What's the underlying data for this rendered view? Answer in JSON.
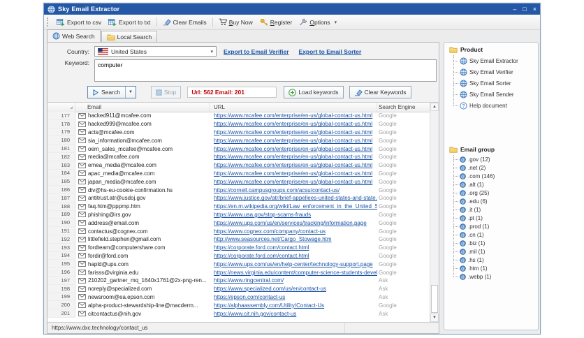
{
  "window": {
    "title": "Sky Email Extractor",
    "controls": [
      "minimize-icon",
      "maximize-icon",
      "close-icon"
    ]
  },
  "toolbar": {
    "buttons": [
      {
        "label": "Export to csv",
        "icon": "export-csv-icon",
        "sep_before": false,
        "mnemonic": ""
      },
      {
        "label": "Export to txt",
        "icon": "export-txt-icon",
        "sep_before": false,
        "mnemonic": ""
      },
      {
        "label": "Clear Emails",
        "icon": "eraser-icon",
        "sep_before": true,
        "mnemonic": ""
      },
      {
        "label": "Buy Now",
        "icon": "cart-icon",
        "sep_before": true,
        "mnemonic": "B"
      },
      {
        "label": "Register",
        "icon": "key-icon",
        "sep_before": false,
        "mnemonic": "R"
      },
      {
        "label": "Options",
        "icon": "wrench-icon",
        "sep_before": false,
        "mnemonic": "O"
      }
    ],
    "overflow_icon": "chevron-down-icon"
  },
  "tabs": [
    {
      "label": "Web Search",
      "icon": "globe-icon",
      "active": true
    },
    {
      "label": "Local Search",
      "icon": "folder-icon",
      "active": false
    }
  ],
  "form": {
    "country_label": "Country:",
    "country_value": "United States",
    "country_flag_icon": "us-flag-icon",
    "verifier_link": "Export to Email Verifier",
    "sorter_link": "Export to Email Sorter",
    "keyword_label": "Keyword:",
    "keyword_value": "computer"
  },
  "actions": {
    "search_label": "Search",
    "stop_label": "Stop",
    "counter": "Url: 562 Email: 201",
    "load_label": "Load keywords",
    "clear_label": "Clear Keywords"
  },
  "table": {
    "headers": [
      "",
      "Email",
      "URL",
      "Search Engine"
    ],
    "rows": [
      {
        "n": "177",
        "email": "hacked911@mcafee.com",
        "url": "https://www.mcafee.com/enterprise/en-us/global-contact-us.html",
        "engine": "Google"
      },
      {
        "n": "178",
        "email": "hacked999@mcafee.com",
        "url": "https://www.mcafee.com/enterprise/en-us/global-contact-us.html",
        "engine": "Google"
      },
      {
        "n": "179",
        "email": "acts@mcafee.com",
        "url": "https://www.mcafee.com/enterprise/en-us/global-contact-us.html",
        "engine": "Google"
      },
      {
        "n": "180",
        "email": "sia_information@mcafee.com",
        "url": "https://www.mcafee.com/enterprise/en-us/global-contact-us.html",
        "engine": "Google"
      },
      {
        "n": "181",
        "email": "oem_sales_mcafee@mcafee.com",
        "url": "https://www.mcafee.com/enterprise/en-us/global-contact-us.html",
        "engine": "Google"
      },
      {
        "n": "182",
        "email": "media@mcafee.com",
        "url": "https://www.mcafee.com/enterprise/en-us/global-contact-us.html",
        "engine": "Google"
      },
      {
        "n": "183",
        "email": "emea_media@mcafee.com",
        "url": "https://www.mcafee.com/enterprise/en-us/global-contact-us.html",
        "engine": "Google"
      },
      {
        "n": "184",
        "email": "apac_media@mcafee.com",
        "url": "https://www.mcafee.com/enterprise/en-us/global-contact-us.html",
        "engine": "Google"
      },
      {
        "n": "185",
        "email": "japan_media@mcafee.com",
        "url": "https://www.mcafee.com/enterprise/en-us/global-contact-us.html",
        "engine": "Google"
      },
      {
        "n": "186",
        "email": "div@hs-eu-cookie-confirmation.hs",
        "url": "https://cornell.campusgroups.com/acsu/contact-us/",
        "engine": "Google"
      },
      {
        "n": "187",
        "email": "antitrust.atr@usdoj.gov",
        "url": "https://www.justice.gov/atr/brief-appellees-united-states-and-state...",
        "engine": "Google"
      },
      {
        "n": "188",
        "email": "faq.htm@pppmp.htm",
        "url": "https://en.m.wikipedia.org/wiki/Law_enforcement_in_the_United_St...",
        "engine": "Google"
      },
      {
        "n": "189",
        "email": "phishing@irs.gov",
        "url": "https://www.usa.gov/stop-scams-frauds",
        "engine": "Google"
      },
      {
        "n": "190",
        "email": "address@email.com",
        "url": "https://www.ups.com/us/en/services/tracking/information.page",
        "engine": "Google"
      },
      {
        "n": "191",
        "email": "contactus@cognex.com",
        "url": "https://www.cognex.com/company/contact-us",
        "engine": "Google"
      },
      {
        "n": "192",
        "email": "littlefield.stephen@gmail.com",
        "url": "http://www.seasources.net/Cargo_Stowage.htm",
        "engine": "Google"
      },
      {
        "n": "193",
        "email": "fordteam@computershare.com",
        "url": "https://corporate.ford.com/contact.html",
        "engine": "Google"
      },
      {
        "n": "194",
        "email": "fordir@ford.com",
        "url": "https://corporate.ford.com/contact.html",
        "engine": "Google"
      },
      {
        "n": "195",
        "email": "hapld@ups.com",
        "url": "https://www.ups.com/us/en/help-center/technology-support.page",
        "engine": "Google"
      },
      {
        "n": "196",
        "email": "farisss@virginia.edu",
        "url": "https://news.virginia.edu/content/computer-science-students-devel...",
        "engine": "Google"
      },
      {
        "n": "197",
        "email": "210202_gartner_mq_1640x1761@2x-png-ren...",
        "url": "https://www.ringcentral.com/",
        "engine": "Ask"
      },
      {
        "n": "198",
        "email": "noreply@specialized.com",
        "url": "https://www.specialized.com/us/en/contact-us",
        "engine": "Ask"
      },
      {
        "n": "199",
        "email": "newsroom@ea.epson.com",
        "url": "https://epson.com/contact-us",
        "engine": "Ask"
      },
      {
        "n": "200",
        "email": "alpha-product-stewardship-line@macderm...",
        "url": "https://alphaassembly.com/Utility/Contact-Us",
        "engine": "Google"
      },
      {
        "n": "201",
        "email": "citcontactus@nih.gov",
        "url": "https://www.cit.nih.gov/contact-us",
        "engine": "Ask"
      }
    ]
  },
  "status": {
    "left_text": "https://www.dxc.technology/contact_us"
  },
  "product_panel": {
    "title": "Product",
    "icon": "folder-icon",
    "items": [
      {
        "label": "Sky Email Extractor",
        "icon": "globe-icon"
      },
      {
        "label": "Sky Email Verifier",
        "icon": "globe-icon"
      },
      {
        "label": "Sky Email Sorter",
        "icon": "globe-icon"
      },
      {
        "label": "Sky Email Sender",
        "icon": "globe-icon"
      },
      {
        "label": "Help document",
        "icon": "help-icon"
      }
    ]
  },
  "email_group_panel": {
    "title": "Email group",
    "icon": "folder-icon",
    "items": [
      {
        "label": ".gov (12)",
        "icon": "at-icon"
      },
      {
        "label": ".net (2)",
        "icon": "at-icon"
      },
      {
        "label": ".com (146)",
        "icon": "at-icon"
      },
      {
        "label": ".alt (1)",
        "icon": "at-icon"
      },
      {
        "label": ".org (25)",
        "icon": "at-icon"
      },
      {
        "label": ".edu (6)",
        "icon": "at-icon"
      },
      {
        "label": ".it (1)",
        "icon": "at-icon"
      },
      {
        "label": ".pt (1)",
        "icon": "at-icon"
      },
      {
        "label": ".prod (1)",
        "icon": "at-icon"
      },
      {
        "label": ".cn (1)",
        "icon": "at-icon"
      },
      {
        "label": ".biz (1)",
        "icon": "at-icon"
      },
      {
        "label": ".mil (1)",
        "icon": "at-icon"
      },
      {
        "label": ".hs (1)",
        "icon": "at-icon"
      },
      {
        "label": ".htm (1)",
        "icon": "at-icon"
      },
      {
        "label": ".webp (1)",
        "icon": "at-icon"
      }
    ]
  },
  "colors": {
    "titlebar": "#2458a6",
    "link_blue": "#1a53a5",
    "counter_red": "#c00000",
    "engine_gray": "#a3a3a3"
  }
}
